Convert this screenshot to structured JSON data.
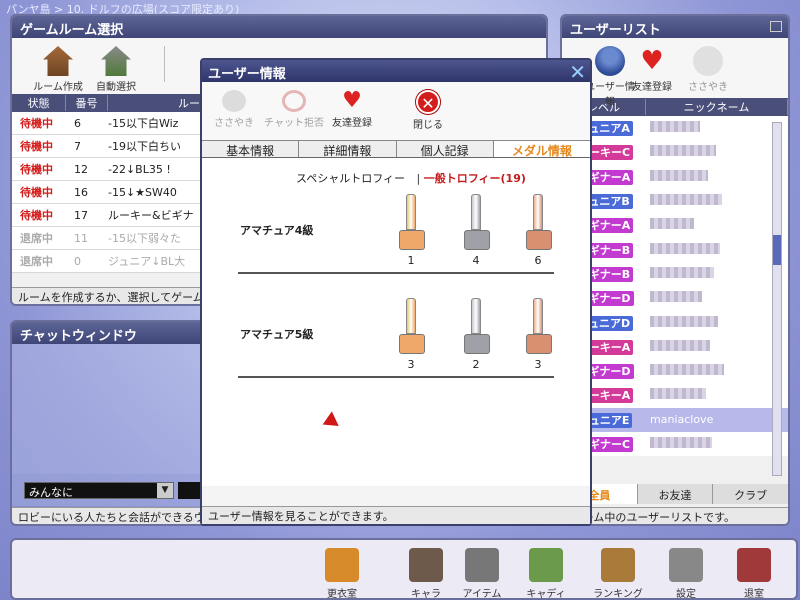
{
  "breadcrumb": "パンヤ島 > 10. ドルフの広場(スコア限定あり)",
  "room_panel": {
    "title": "ゲームルーム選択",
    "tools": [
      "ルーム作成",
      "自動選択"
    ],
    "columns": [
      "状態",
      "番号",
      "ルー"
    ],
    "rows": [
      {
        "status": "待機中",
        "number": "6",
        "name": "-15以下白Wiz"
      },
      {
        "status": "待機中",
        "number": "7",
        "name": "-19以下白ちい"
      },
      {
        "status": "待機中",
        "number": "12",
        "name": "-22↓BL35 !"
      },
      {
        "status": "待機中",
        "number": "16",
        "name": "-15↓★SW40"
      },
      {
        "status": "待機中",
        "number": "17",
        "name": "ルーキー&ビギナ"
      },
      {
        "status": "退席中",
        "number": "11",
        "name": "-15以下弱々た"
      },
      {
        "status": "退席中",
        "number": "0",
        "name": "ジュニア↓BL大"
      }
    ],
    "status_text": "ルームを作成するか、選択してゲームを始"
  },
  "chat_panel": {
    "title": "チャットウィンドウ",
    "target": "みんなに",
    "status_text": "ロビーにいる人たちと会話ができるウィン"
  },
  "user_list": {
    "title": "ユーザーリスト",
    "tools": [
      "ユーザー情報",
      "友達登録",
      "ささやき"
    ],
    "columns": [
      "レベル",
      "ニックネーム"
    ],
    "users": [
      {
        "level": "ジュニアA",
        "color": "#4a6ad8",
        "nick": ""
      },
      {
        "level": "ルーキーC",
        "color": "#d43a9a",
        "nick": ""
      },
      {
        "level": "ビギナーA",
        "color": "#c23ad0",
        "nick": ""
      },
      {
        "level": "ジュニアB",
        "color": "#4a6ad8",
        "nick": ""
      },
      {
        "level": "ビギナーA",
        "color": "#c23ad0",
        "nick": ""
      },
      {
        "level": "ビギナーB",
        "color": "#c23ad0",
        "nick": ""
      },
      {
        "level": "ビギナーB",
        "color": "#c23ad0",
        "nick": ""
      },
      {
        "level": "ビギナーD",
        "color": "#c23ad0",
        "nick": ""
      },
      {
        "level": "ジュニアD",
        "color": "#4a6ad8",
        "nick": ""
      },
      {
        "level": "ルーキーA",
        "color": "#d43a9a",
        "nick": ""
      },
      {
        "level": "ビギナーD",
        "color": "#c23ad0",
        "nick": ""
      },
      {
        "level": "ルーキーA",
        "color": "#d43a9a",
        "nick": ""
      },
      {
        "level": "ジュニアE",
        "color": "#4a6ad8",
        "nick": "maniaclove",
        "selected": true
      },
      {
        "level": "ビギナーC",
        "color": "#c23ad0",
        "nick": ""
      }
    ],
    "tabs": [
      "全員",
      "お友達",
      "クラブ"
    ],
    "status_text": "/ゲーム中のユーザーリストです。"
  },
  "dialog": {
    "title": "ユーザー情報",
    "tools": [
      "ささやき",
      "チャット拒否",
      "友達登録",
      "閉じる"
    ],
    "tabs": [
      "基本情報",
      "詳細情報",
      "個人記録",
      "メダル情報"
    ],
    "filter_special": "スペシャルトロフィー",
    "filter_general": "一般トロフィー(19)",
    "rows": [
      {
        "label": "アマチュア4級",
        "counts": [
          "1",
          "4",
          "6"
        ]
      },
      {
        "label": "アマチュア5級",
        "counts": [
          "3",
          "2",
          "3"
        ]
      }
    ],
    "status_text": "ユーザー情報を見ることができます。"
  },
  "bottom_menu": [
    "更衣室",
    "キャラ",
    "アイテム",
    "キャディ",
    "ランキング",
    "設定",
    "退室"
  ]
}
